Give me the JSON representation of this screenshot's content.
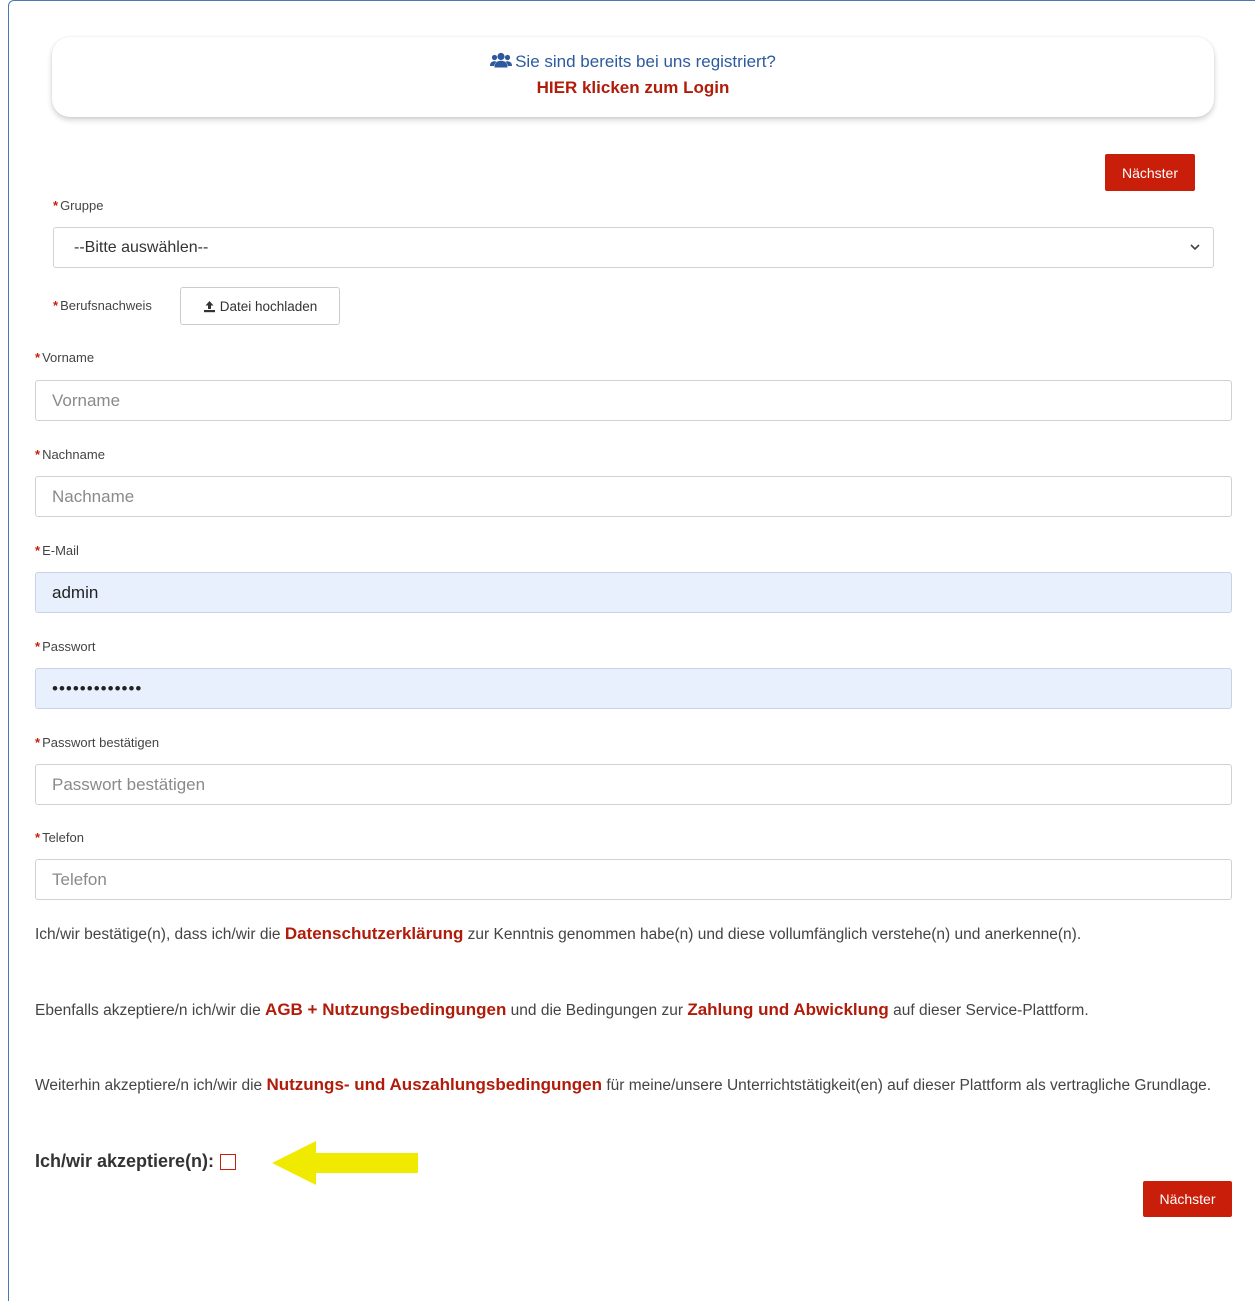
{
  "login_card": {
    "question": "Sie sind bereits bei uns registriert?",
    "login_link": "HIER klicken zum Login",
    "icon": "users-icon"
  },
  "buttons": {
    "next_top": "Nächster",
    "next_bottom": "Nächster",
    "upload": "Datei hochladen"
  },
  "required_marker": "*",
  "form": {
    "gruppe_label": "Gruppe",
    "gruppe_selected": "--Bitte auswählen--",
    "berufsnachweis_label": "Berufsnachweis",
    "vorname_label": "Vorname",
    "vorname_placeholder": "Vorname",
    "nachname_label": "Nachname",
    "nachname_placeholder": "Nachname",
    "email_label": "E-Mail",
    "email_value": "admin",
    "passwort_label": "Passwort",
    "passwort_value": "•••••••••••••",
    "passwort_confirm_label": "Passwort bestätigen",
    "passwort_confirm_placeholder": "Passwort bestätigen",
    "telefon_label": "Telefon",
    "telefon_placeholder": "Telefon"
  },
  "terms": {
    "p1_pre": "Ich/wir bestätige(n), dass ich/wir die ",
    "p1_link": "Datenschutzerklärung",
    "p1_post": " zur Kenntnis genommen habe(n) und diese vollumfänglich verstehe(n) und anerkenne(n).",
    "p2_pre": "Ebenfalls akzeptiere/n ich/wir die ",
    "p2_link1": "AGB + Nutzungsbedingungen",
    "p2_mid": " und die Bedingungen zur ",
    "p2_link2": "Zahlung und Abwicklung",
    "p2_post": " auf dieser Service-Plattform.",
    "p3_pre": "Weiterhin akzeptiere/n ich/wir die ",
    "p3_link": "Nutzungs- und Auszahlungsbedingungen",
    "p3_post": " für meine/unsere Unterrichtstätigkeit(en) auf dieser Plattform als vertragliche Grundlage.",
    "accept_label": "Ich/wir akzeptiere(n):"
  },
  "colors": {
    "accent_red": "#c81e0a",
    "link_blue": "#2d5a9e",
    "autofill_bg": "#e8f0fe",
    "highlight_arrow": "#f0ea00"
  }
}
